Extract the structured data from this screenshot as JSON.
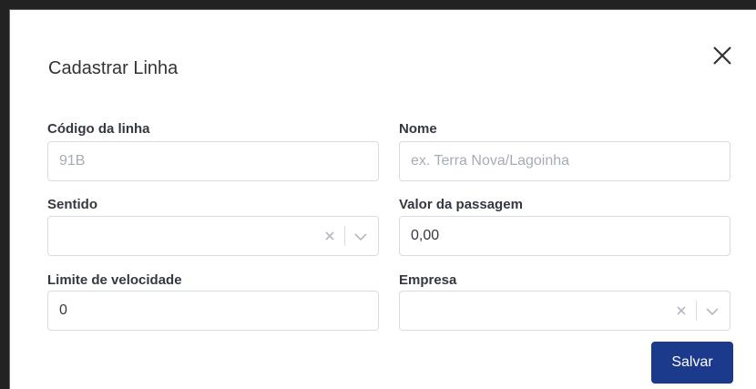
{
  "dialog": {
    "title": "Cadastrar Linha"
  },
  "fields": {
    "codigo": {
      "label": "Código da linha",
      "value": "91B"
    },
    "nome": {
      "label": "Nome",
      "placeholder": "ex. Terra Nova/Lagoinha"
    },
    "sentido": {
      "label": "Sentido",
      "value": ""
    },
    "valor": {
      "label": "Valor da passagem",
      "value": "0,00"
    },
    "limite": {
      "label": "Limite de velocidade",
      "value": "0"
    },
    "empresa": {
      "label": "Empresa",
      "value": ""
    }
  },
  "actions": {
    "save_label": "Salvar"
  },
  "colors": {
    "primary": "#1c3a8c",
    "border": "#d9dce3",
    "placeholder": "#a6acb6"
  },
  "icons": [
    "close-icon",
    "clear-icon",
    "chevron-down-icon"
  ]
}
